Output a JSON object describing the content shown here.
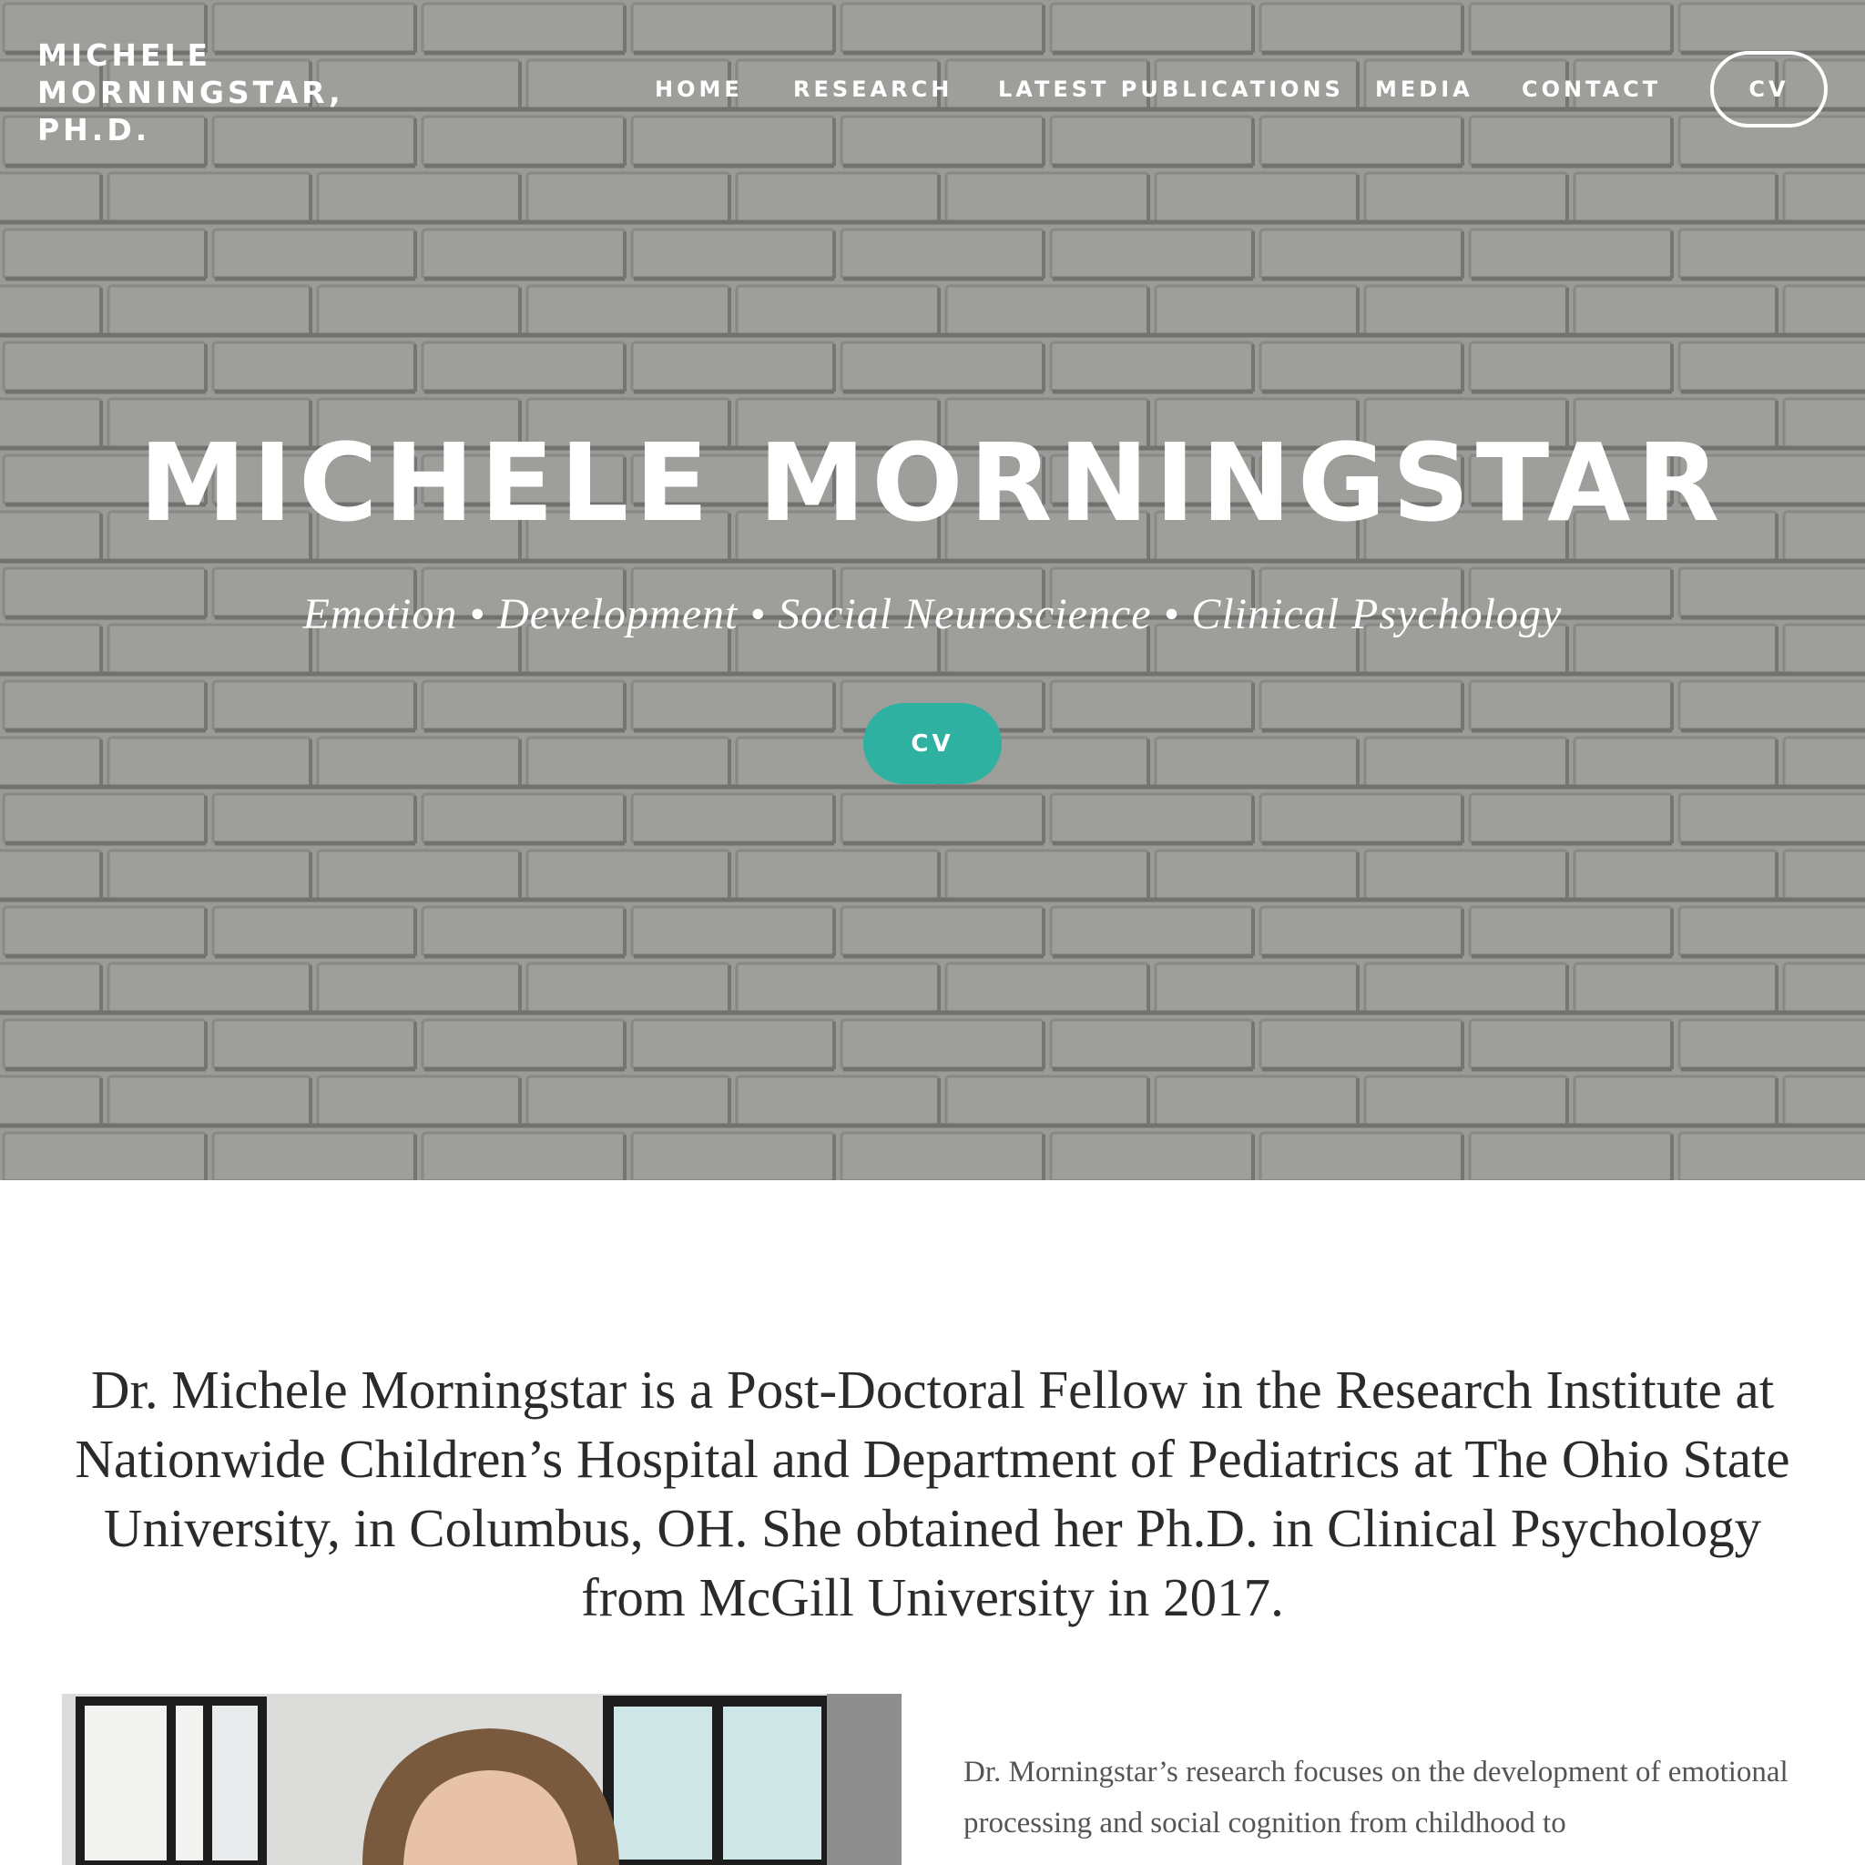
{
  "header": {
    "site_title_lines": [
      "MICHELE",
      "MORNINGSTAR,",
      "PH.D."
    ],
    "nav": [
      {
        "label": "HOME"
      },
      {
        "label": "RESEARCH"
      },
      {
        "label": "LATEST PUBLICATIONS"
      },
      {
        "label": "MEDIA"
      },
      {
        "label": "CONTACT"
      }
    ],
    "cv_button": "CV"
  },
  "hero": {
    "heading": "MICHELE MORNINGSTAR",
    "tagline": "Emotion • Development • Social Neuroscience • Clinical Psychology",
    "cv_button": "CV"
  },
  "intro": {
    "text": "Dr. Michele Morningstar is a Post-Doctoral Fellow in the Research Institute at Nationwide Children’s Hospital and Department of Pediatrics at The Ohio State University, in Columbus, OH. She obtained her Ph.D. in Clinical Psychology from McGill University in 2017."
  },
  "bio": {
    "text": "Dr. Morningstar’s research focuses on the development of emotional processing and social cognition from childhood to"
  },
  "colors": {
    "accent": "#2fb1a1",
    "hero_bg": "#9c9c9a",
    "text_dark": "#2b2b2b",
    "text_muted": "#555555"
  }
}
